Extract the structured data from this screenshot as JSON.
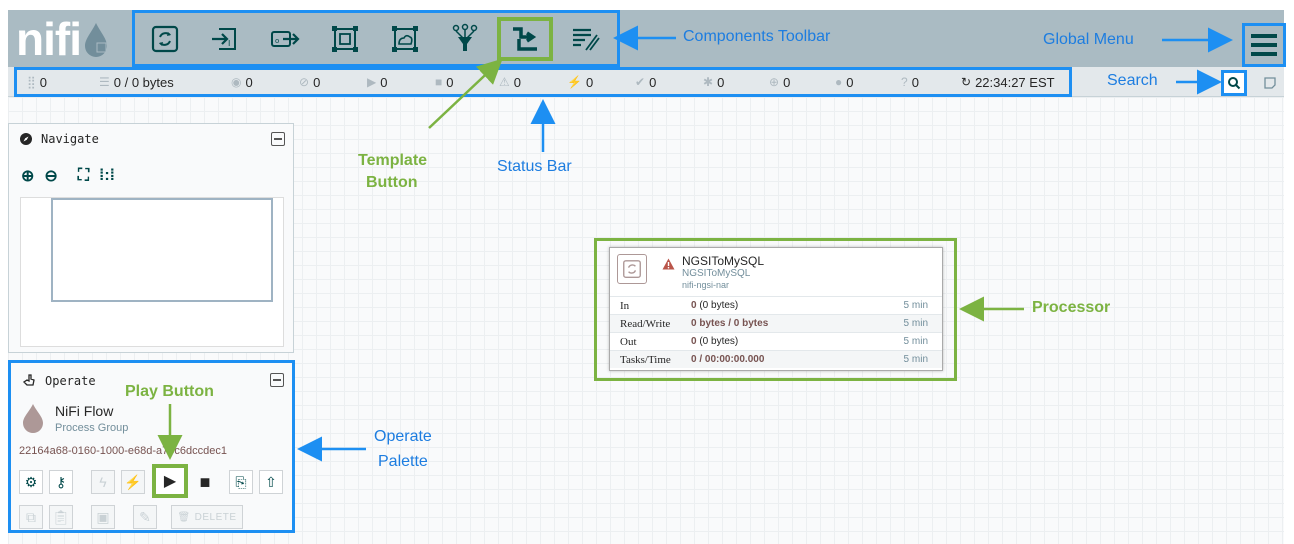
{
  "header": {
    "logo_text": "nifi"
  },
  "components_toolbar": {
    "buttons": [
      "processor",
      "input-port",
      "output-port",
      "process-group",
      "remote-process-group",
      "funnel",
      "template",
      "label"
    ]
  },
  "status_bar": {
    "active_threads": "0",
    "queued": "0 / 0 bytes",
    "transmitting": "0",
    "not_transmitting": "0",
    "running": "0",
    "stopped": "0",
    "invalid": "0",
    "disabled": "0",
    "up_to_date": "0",
    "locally_modified": "0",
    "stale": "0",
    "locally_modified_stale": "0",
    "sync_failure": "0",
    "last_refreshed": "22:34:27 EST"
  },
  "navigate": {
    "title": "Navigate"
  },
  "operate": {
    "title": "Operate",
    "name": "NiFi Flow",
    "type": "Process Group",
    "id": "22164a68-0160-1000-e68d-a75c6dccdec1",
    "delete_label": "DELETE"
  },
  "processor": {
    "name": "NGSIToMySQL",
    "type": "NGSIToMySQL",
    "bundle": "nifi-ngsi-nar",
    "rows": [
      {
        "label": "In",
        "value_bold": "0",
        "value_rest": " (0 bytes)",
        "time": "5 min"
      },
      {
        "label": "Read/Write",
        "value_bold": "0 bytes / 0 bytes",
        "value_rest": "",
        "time": "5 min"
      },
      {
        "label": "Out",
        "value_bold": "0",
        "value_rest": " (0 bytes)",
        "time": "5 min"
      },
      {
        "label": "Tasks/Time",
        "value_bold": "0 / 00:00:00.000",
        "value_rest": "",
        "time": "5 min"
      }
    ]
  },
  "annotations": {
    "components_toolbar": "Components Toolbar",
    "global_menu": "Global Menu",
    "search": "Search",
    "template_button_line1": "Template",
    "template_button_line2": "Button",
    "status_bar": "Status Bar",
    "processor": "Processor",
    "play_button": "Play Button",
    "operate_palette_line1": "Operate",
    "operate_palette_line2": "Palette"
  },
  "colors": {
    "header": "#aabbc3",
    "annotation_blue": "#1d8ff2",
    "annotation_green": "#7cb342",
    "text_accent": "#775351"
  }
}
